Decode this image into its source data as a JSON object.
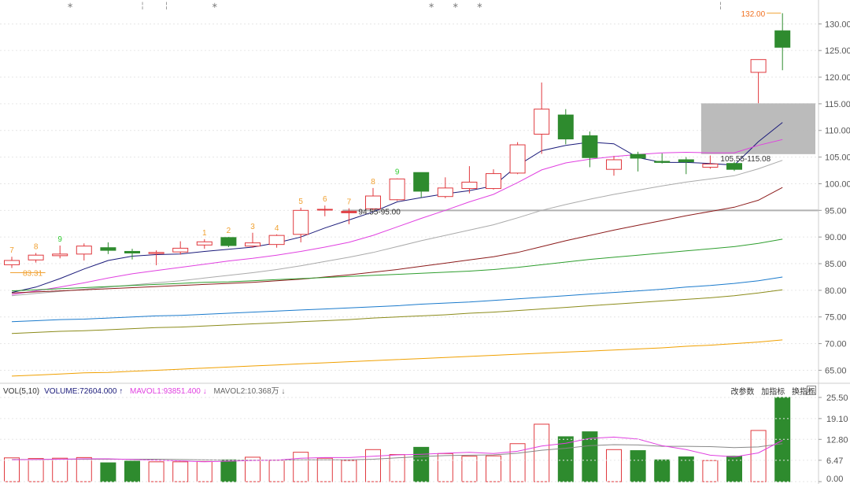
{
  "colors": {
    "up": "#e0393e",
    "down": "#2e8b2e",
    "ma5": "#1a1a7a",
    "ma10": "#e040e0",
    "ma20": "#aaaaaa",
    "ma60": "#8b1a1a",
    "ma120": "#2e9e2e",
    "ma250": "#1a7acc",
    "ma500": "#8b8b1a",
    "ma1000": "#f0a000",
    "zone": "#b4b4b4",
    "grid": "#e6e6e6",
    "axis_text": "#555555"
  },
  "chart_data": [
    {
      "type": "candlestick",
      "ylim": [
        63,
        133
      ],
      "yticks": [
        65,
        70,
        75,
        80,
        85,
        90,
        95,
        100,
        105,
        110,
        115,
        120,
        125,
        130
      ],
      "ytick_labels": [
        "65.00",
        "70.00",
        "75.00",
        "80.00",
        "85.00",
        "90.00",
        "95.00",
        "100.00",
        "105.00",
        "110.00",
        "115.00",
        "120.00",
        "125.00",
        "130.00"
      ],
      "grid": "horizontal dotted",
      "candles": [
        {
          "o": 84.8,
          "c": 85.6,
          "h": 86.3,
          "l": 84.2
        },
        {
          "o": 85.7,
          "c": 86.6,
          "h": 87.0,
          "l": 85.2
        },
        {
          "o": 86.5,
          "c": 86.8,
          "h": 88.4,
          "l": 86.0
        },
        {
          "o": 86.8,
          "c": 88.3,
          "h": 88.8,
          "l": 85.6
        },
        {
          "o": 88.0,
          "c": 87.5,
          "h": 89.0,
          "l": 86.8
        },
        {
          "o": 87.3,
          "c": 87.0,
          "h": 87.8,
          "l": 85.8
        },
        {
          "o": 86.9,
          "c": 87.1,
          "h": 87.5,
          "l": 84.7
        },
        {
          "o": 87.2,
          "c": 87.9,
          "h": 89.2,
          "l": 86.7
        },
        {
          "o": 88.5,
          "c": 89.1,
          "h": 89.6,
          "l": 87.8
        },
        {
          "o": 89.9,
          "c": 88.4,
          "h": 90.0,
          "l": 88.1
        },
        {
          "o": 88.3,
          "c": 88.9,
          "h": 90.8,
          "l": 88.0
        },
        {
          "o": 88.6,
          "c": 90.3,
          "h": 90.5,
          "l": 88.0
        },
        {
          "o": 90.5,
          "c": 95.0,
          "h": 95.5,
          "l": 89.0
        },
        {
          "o": 95.1,
          "c": 95.2,
          "h": 95.9,
          "l": 93.9
        },
        {
          "o": 94.6,
          "c": 94.7,
          "h": 95.4,
          "l": 92.4
        },
        {
          "o": 95.3,
          "c": 97.7,
          "h": 99.2,
          "l": 95.0
        },
        {
          "o": 97.0,
          "c": 100.9,
          "h": 101.0,
          "l": 96.8
        },
        {
          "o": 102.1,
          "c": 98.6,
          "h": 102.1,
          "l": 97.4
        },
        {
          "o": 97.6,
          "c": 99.2,
          "h": 101.2,
          "l": 97.3
        },
        {
          "o": 99.1,
          "c": 100.3,
          "h": 103.3,
          "l": 98.2
        },
        {
          "o": 99.1,
          "c": 101.9,
          "h": 102.7,
          "l": 98.9
        },
        {
          "o": 102.0,
          "c": 107.3,
          "h": 107.8,
          "l": 101.8
        },
        {
          "o": 109.3,
          "c": 114.0,
          "h": 119.0,
          "l": 105.6
        },
        {
          "o": 112.9,
          "c": 108.4,
          "h": 114.0,
          "l": 107.4
        },
        {
          "o": 109.0,
          "c": 104.9,
          "h": 109.8,
          "l": 103.1
        },
        {
          "o": 102.7,
          "c": 104.5,
          "h": 105.2,
          "l": 101.5
        },
        {
          "o": 105.5,
          "c": 104.8,
          "h": 106.0,
          "l": 102.3
        },
        {
          "o": 104.2,
          "c": 104.0,
          "h": 105.7,
          "l": 103.8
        },
        {
          "o": 104.5,
          "c": 104.1,
          "h": 105.0,
          "l": 101.8
        },
        {
          "o": 103.1,
          "c": 103.7,
          "h": 105.3,
          "l": 102.8
        },
        {
          "o": 103.8,
          "c": 102.7,
          "h": 104.1,
          "l": 102.4
        },
        {
          "o": 120.9,
          "c": 123.3,
          "h": 123.3,
          "l": 115.1
        },
        {
          "o": 128.7,
          "c": 125.6,
          "h": 132.0,
          "l": 121.3
        }
      ],
      "tdx": [
        "7",
        "8",
        "9",
        "",
        "",
        "",
        "",
        "",
        "1",
        "2",
        "3",
        "4",
        "5",
        "6",
        "7",
        "8",
        "9",
        "",
        "",
        "",
        "",
        "",
        "",
        "",
        "",
        "",
        "",
        "",
        "",
        "",
        "",
        "",
        ""
      ],
      "top_markers": [
        2,
        5,
        6,
        8,
        17,
        18,
        19,
        29
      ],
      "annotations": [
        {
          "index": 0,
          "price": 83.31,
          "text": "83.31"
        },
        {
          "index": 14,
          "price": 95.0,
          "text": "94.55-95.00"
        },
        {
          "index": 32,
          "price": 132.0,
          "text": "132.00"
        },
        {
          "index": 29,
          "price": 105.55,
          "text": "105.55-115.08"
        }
      ],
      "hline": 95.0,
      "zone": {
        "from": 105.55,
        "to": 115.08
      },
      "ma": [
        {
          "name": "ma5",
          "values": [
            79.6,
            80.6,
            82.2,
            84.0,
            85.6,
            86.4,
            86.7,
            86.8,
            87.3,
            87.7,
            88.1,
            88.9,
            90.0,
            91.7,
            93.2,
            94.7,
            96.6,
            97.4,
            98.1,
            98.7,
            99.6,
            103.4,
            106.2,
            107.2,
            107.8,
            107.5,
            104.9,
            104.0,
            104.0,
            103.8,
            103.5,
            107.9,
            111.5
          ]
        },
        {
          "name": "ma10",
          "values": [
            79.2,
            79.9,
            80.6,
            81.4,
            82.3,
            83.1,
            83.7,
            84.3,
            84.9,
            85.5,
            86.0,
            86.6,
            87.3,
            88.1,
            89.0,
            90.3,
            91.9,
            93.5,
            95.0,
            96.6,
            98.0,
            100.2,
            102.6,
            103.9,
            104.6,
            105.1,
            105.5,
            105.8,
            105.9,
            105.8,
            105.8,
            107.2,
            108.3
          ]
        },
        {
          "name": "ma20",
          "values": [
            79.0,
            79.4,
            79.8,
            80.2,
            80.6,
            81.0,
            81.4,
            81.8,
            82.3,
            82.8,
            83.3,
            83.9,
            84.6,
            85.4,
            86.2,
            87.1,
            88.2,
            89.3,
            90.3,
            91.3,
            92.3,
            93.6,
            95.0,
            96.1,
            97.1,
            98.0,
            98.8,
            99.6,
            100.3,
            100.9,
            101.5,
            102.8,
            104.4
          ]
        },
        {
          "name": "ma60",
          "values": [
            79.5,
            79.7,
            79.9,
            80.1,
            80.3,
            80.5,
            80.7,
            80.9,
            81.1,
            81.3,
            81.5,
            81.8,
            82.1,
            82.5,
            82.9,
            83.4,
            83.9,
            84.5,
            85.1,
            85.7,
            86.3,
            87.1,
            88.2,
            89.3,
            90.3,
            91.3,
            92.2,
            93.1,
            94.0,
            94.8,
            95.6,
            96.9,
            99.3
          ]
        },
        {
          "name": "ma120",
          "values": [
            79.9,
            80.1,
            80.3,
            80.5,
            80.7,
            80.9,
            81.1,
            81.3,
            81.5,
            81.6,
            81.8,
            82.0,
            82.2,
            82.4,
            82.6,
            82.8,
            83.0,
            83.2,
            83.4,
            83.6,
            83.9,
            84.3,
            84.8,
            85.3,
            85.8,
            86.2,
            86.6,
            87.0,
            87.4,
            87.8,
            88.2,
            88.8,
            89.6
          ]
        },
        {
          "name": "ma250",
          "values": [
            74.1,
            74.3,
            74.5,
            74.6,
            74.8,
            75.0,
            75.2,
            75.3,
            75.5,
            75.7,
            75.9,
            76.1,
            76.3,
            76.5,
            76.7,
            76.9,
            77.1,
            77.4,
            77.6,
            77.8,
            78.1,
            78.4,
            78.7,
            79.0,
            79.3,
            79.6,
            79.9,
            80.2,
            80.6,
            80.9,
            81.3,
            81.8,
            82.5
          ]
        },
        {
          "name": "ma500",
          "values": [
            71.9,
            72.1,
            72.3,
            72.4,
            72.6,
            72.8,
            73.0,
            73.1,
            73.3,
            73.5,
            73.7,
            73.9,
            74.1,
            74.3,
            74.5,
            74.8,
            75.0,
            75.2,
            75.4,
            75.7,
            75.9,
            76.2,
            76.5,
            76.8,
            77.1,
            77.4,
            77.7,
            78.0,
            78.3,
            78.6,
            79.0,
            79.5,
            80.1
          ]
        },
        {
          "name": "ma1000",
          "values": [
            63.9,
            64.1,
            64.3,
            64.5,
            64.6,
            64.8,
            65.0,
            65.2,
            65.4,
            65.6,
            65.8,
            66.0,
            66.2,
            66.4,
            66.6,
            66.8,
            67.0,
            67.2,
            67.4,
            67.6,
            67.8,
            68.0,
            68.2,
            68.4,
            68.6,
            68.8,
            69.0,
            69.2,
            69.5,
            69.7,
            70.0,
            70.3,
            70.7
          ]
        }
      ]
    },
    {
      "type": "bar",
      "ylim": [
        0,
        25.5
      ],
      "yticks": [
        0.0,
        6.47,
        12.8,
        19.1,
        25.5
      ],
      "ytick_labels": [
        "0.00",
        "6.47",
        "12.80",
        "19.10",
        "25.50"
      ],
      "values": [
        7.2,
        7.0,
        7.1,
        7.3,
        5.7,
        6.2,
        6.0,
        6.0,
        6.1,
        6.6,
        7.4,
        6.5,
        8.9,
        7.1,
        6.4,
        9.7,
        8.2,
        10.4,
        8.5,
        7.7,
        7.8,
        11.5,
        17.4,
        13.6,
        15.1,
        9.7,
        9.4,
        6.6,
        7.5,
        6.4,
        7.7,
        15.5,
        25.5
      ],
      "ma5": [
        6.6,
        6.7,
        6.8,
        6.9,
        6.9,
        6.7,
        6.5,
        6.3,
        6.0,
        6.2,
        6.4,
        6.5,
        7.1,
        7.3,
        7.3,
        7.7,
        8.1,
        8.3,
        8.6,
        8.9,
        8.5,
        9.2,
        10.8,
        11.6,
        13.1,
        13.5,
        12.9,
        10.9,
        9.7,
        8.0,
        7.5,
        8.7,
        12.5
      ],
      "ma10": [
        6.7,
        6.7,
        6.8,
        6.8,
        6.8,
        6.8,
        6.8,
        6.7,
        6.6,
        6.5,
        6.5,
        6.5,
        6.6,
        6.6,
        6.6,
        6.8,
        7.2,
        7.6,
        7.9,
        8.0,
        8.1,
        8.6,
        9.5,
        10.1,
        10.9,
        11.2,
        11.1,
        10.7,
        10.7,
        10.6,
        10.3,
        10.5,
        11.5
      ]
    }
  ],
  "volume_panel": {
    "label": "VOL(5,10)",
    "volume": "VOLUME:72604.000",
    "mavol1": "MAVOL1:93851.400",
    "mavol2": "MAVOL2:10.368万",
    "arrow_up": "↑",
    "arrow_down1": "↓",
    "arrow_down2": "↓",
    "tools": [
      "改参数",
      "加指标",
      "换指标"
    ],
    "close": "×"
  }
}
